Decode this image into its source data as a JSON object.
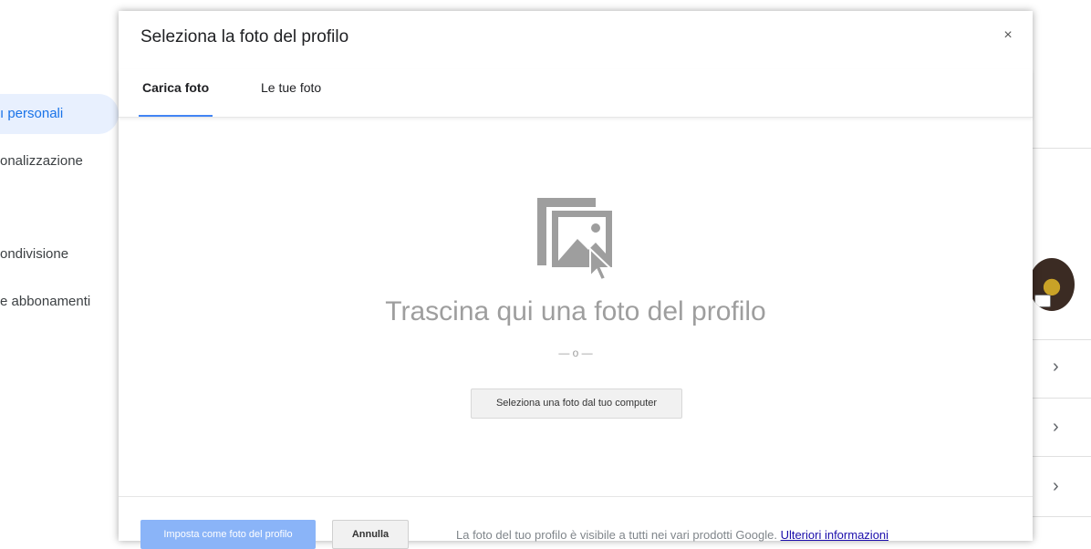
{
  "background": {
    "nav_items": [
      {
        "label": "ı personali",
        "active": true
      },
      {
        "label": "onalizzazione",
        "active": false
      },
      {
        "label": "ondivisione",
        "active": false
      },
      {
        "label": "e abbonamenti",
        "active": false
      }
    ],
    "chevron": "›"
  },
  "dialog": {
    "title": "Seleziona la foto del profilo",
    "close_symbol": "×",
    "tabs": [
      {
        "label": "Carica foto",
        "active": true
      },
      {
        "label": "Le tue foto",
        "active": false
      }
    ],
    "drop_icon": "photo-drag-icon",
    "drop_text": "Trascina qui una foto del profilo",
    "or_text": "— o —",
    "select_button": "Seleziona una foto dal tuo computer",
    "footer": {
      "set_button": "Imposta come foto del profilo",
      "cancel_button": "Annulla",
      "info_text": "La foto del tuo profilo è visibile a tutti nei vari prodotti Google.",
      "info_link": "Ulteriori informazioni"
    }
  },
  "colors": {
    "accent": "#4285f4",
    "disabled_primary": "#8ab4f8",
    "muted_text": "#9e9e9e",
    "link": "#1a0dab"
  }
}
